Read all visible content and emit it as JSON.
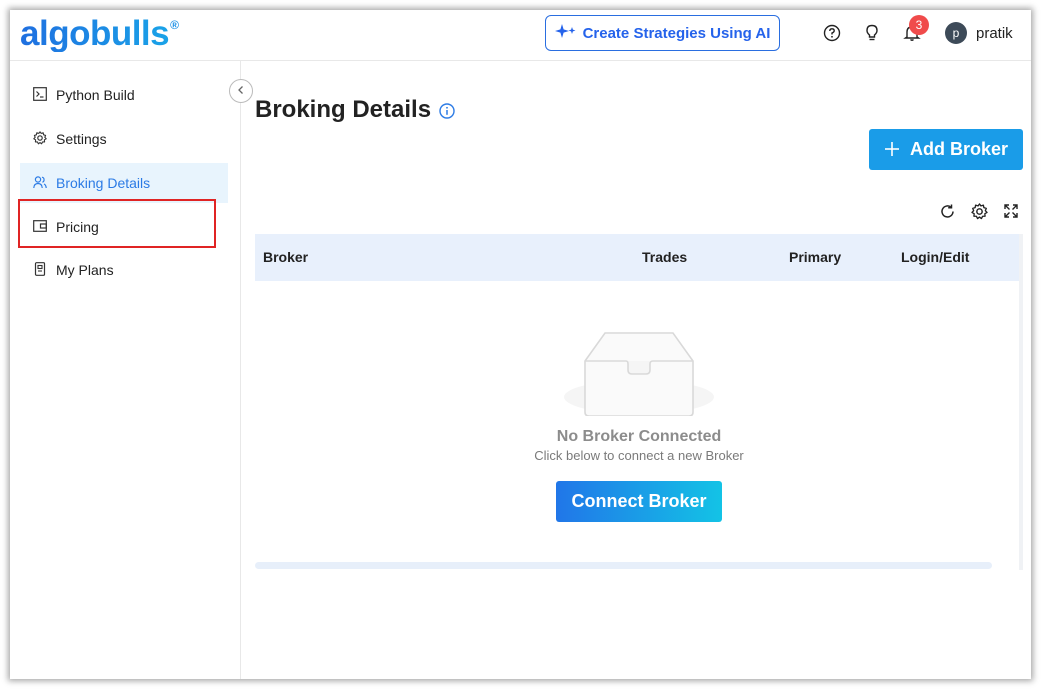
{
  "header": {
    "logo_text": "algobulls",
    "logo_mark": "®",
    "ai_button_label": "Create Strategies Using AI",
    "ai_button_icon": "sparkle-icon",
    "notification_count": "3",
    "user_initial": "p",
    "user_name": "pratik"
  },
  "sidebar": {
    "items": [
      {
        "label": "Python Build",
        "icon": "terminal-icon"
      },
      {
        "label": "Settings",
        "icon": "gear-icon"
      },
      {
        "label": "Broking Details",
        "icon": "users-icon"
      },
      {
        "label": "Pricing",
        "icon": "wallet-icon"
      },
      {
        "label": "My Plans",
        "icon": "plan-icon"
      }
    ],
    "active_index": 2
  },
  "main": {
    "title": "Broking Details",
    "add_button_label": "Add Broker",
    "table": {
      "columns": [
        "Broker",
        "Trades",
        "Primary",
        "Login/Edit"
      ]
    },
    "empty": {
      "title": "No Broker Connected",
      "subtitle": "Click below to connect a new Broker",
      "button_label": "Connect Broker"
    }
  },
  "colors": {
    "brand_blue": "#1a8fe6",
    "accent_blue": "#2563eb",
    "active_bg": "#e8f4fd",
    "badge_red": "#f04b4b",
    "highlight_red": "#e02424",
    "table_header_bg": "#e8f0fc"
  }
}
